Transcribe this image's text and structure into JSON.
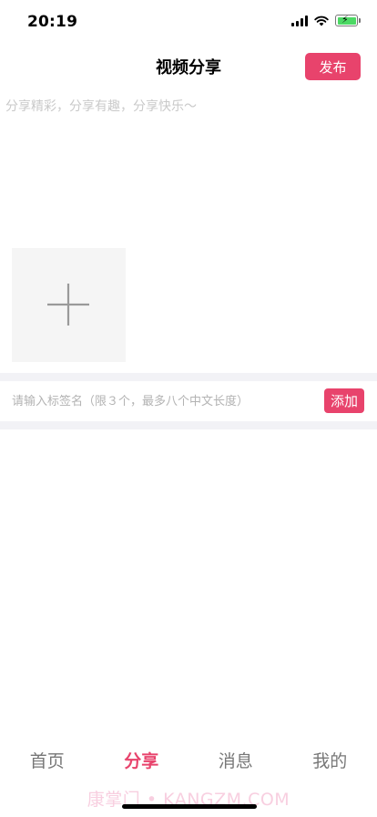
{
  "status_bar": {
    "time": "20:19",
    "icons": [
      "cellular-signal-icon",
      "wifi-icon",
      "battery-charging-icon"
    ]
  },
  "header": {
    "title": "视频分享",
    "publish_label": "发布"
  },
  "description": {
    "placeholder": "分享精彩，分享有趣，分享快乐～"
  },
  "media": {
    "add_icon": "plus-icon"
  },
  "tags": {
    "placeholder": "请输入标签名（限３个，最多八个中文长度）",
    "add_label": "添加"
  },
  "tab_bar": {
    "items": [
      {
        "label": "首页"
      },
      {
        "label": "分享"
      },
      {
        "label": "消息"
      },
      {
        "label": "我的"
      }
    ],
    "active_index": 1
  },
  "watermark": "康掌门 • KANGZM.COM",
  "colors": {
    "accent": "#e8436c",
    "divider": "#f2f2f6",
    "placeholder": "#c9c9c9",
    "inactive_tab": "#777777",
    "battery": "#4cd964"
  }
}
